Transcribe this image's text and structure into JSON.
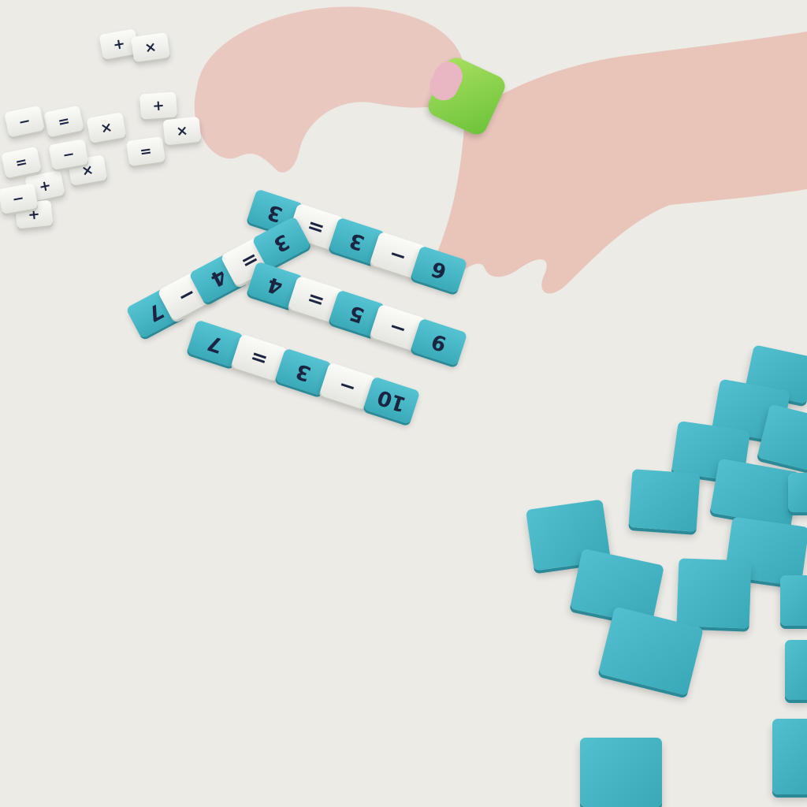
{
  "scene": {
    "background": "#ecebe6",
    "tile_blue": "#46b7c6",
    "tile_white": "#f4f4f0",
    "symbol_color": "#1b2440"
  },
  "equations": [
    {
      "tiles": [
        "3",
        "=",
        "3",
        "−",
        "6"
      ]
    },
    {
      "tiles": [
        "7",
        "−",
        "4",
        "=",
        "3"
      ]
    },
    {
      "tiles": [
        "4",
        "=",
        "5",
        "−",
        "9"
      ]
    },
    {
      "tiles": [
        "7",
        "=",
        "3",
        "−",
        "10"
      ]
    }
  ],
  "loose_operator_tiles": [
    "+",
    "×",
    "=",
    "+",
    "×",
    "=",
    "×",
    "−",
    "+",
    "×",
    "−",
    "=",
    "+",
    "−"
  ]
}
